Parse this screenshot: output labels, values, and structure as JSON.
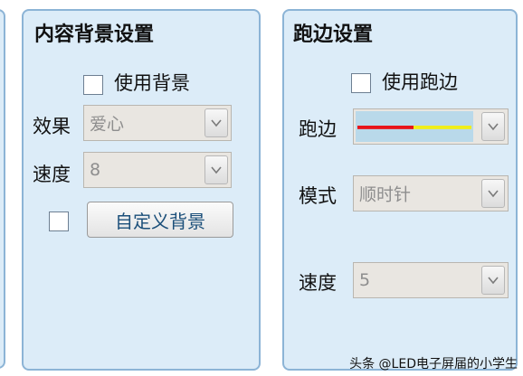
{
  "content_bg_panel": {
    "title": "内容背景设置",
    "use_bg_label": "使用背景",
    "effect_label": "效果",
    "effect_value": "爱心",
    "speed_label": "速度",
    "speed_value": "8",
    "custom_bg_button": "自定义背景"
  },
  "border_panel": {
    "title": "跑边设置",
    "use_border_label": "使用跑边",
    "border_label": "跑边",
    "border_preview_colors": [
      "#e8141a",
      "#f0ee1a"
    ],
    "mode_label": "模式",
    "mode_value": "顺时针",
    "speed_label": "速度",
    "speed_value": "5"
  },
  "watermark": "头条 @LED电子屏届的小学生"
}
